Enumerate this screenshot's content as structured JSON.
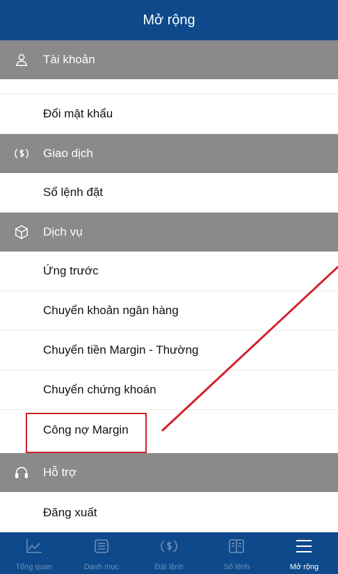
{
  "header": {
    "title": "Mở rộng"
  },
  "sections": [
    {
      "label": "Tài khoản",
      "icon": "user-icon"
    },
    {
      "label": "Giao dịch",
      "icon": "dollar-circle-icon"
    },
    {
      "label": "Dịch vụ",
      "icon": "box-icon"
    },
    {
      "label": "Hỗ trợ",
      "icon": "headphones-icon"
    }
  ],
  "account_items": [
    "Đổi mật khẩu"
  ],
  "trade_items": [
    "Sổ lệnh đặt"
  ],
  "service_items": [
    "Ứng trước",
    "Chuyển khoản ngân hàng",
    "Chuyển tiền Margin - Thường",
    "Chuyển chứng khoán",
    "Công nợ Margin"
  ],
  "support_items": [
    "Đăng xuất"
  ],
  "tabbar": {
    "tabs": [
      {
        "label": "Tổng quan",
        "icon": "chart-icon"
      },
      {
        "label": "Danh mục",
        "icon": "list-icon"
      },
      {
        "label": "Đặt lệnh",
        "icon": "dollar-icon"
      },
      {
        "label": "Sổ lệnh",
        "icon": "book-icon"
      },
      {
        "label": "Mở rộng",
        "icon": "menu-icon"
      }
    ],
    "active": "Mở rộng"
  },
  "colors": {
    "header": "#0e4a8b",
    "section": "#8a8a8a",
    "annotation": "#d11f2b",
    "tab_inactive": "#6f8fb7"
  }
}
